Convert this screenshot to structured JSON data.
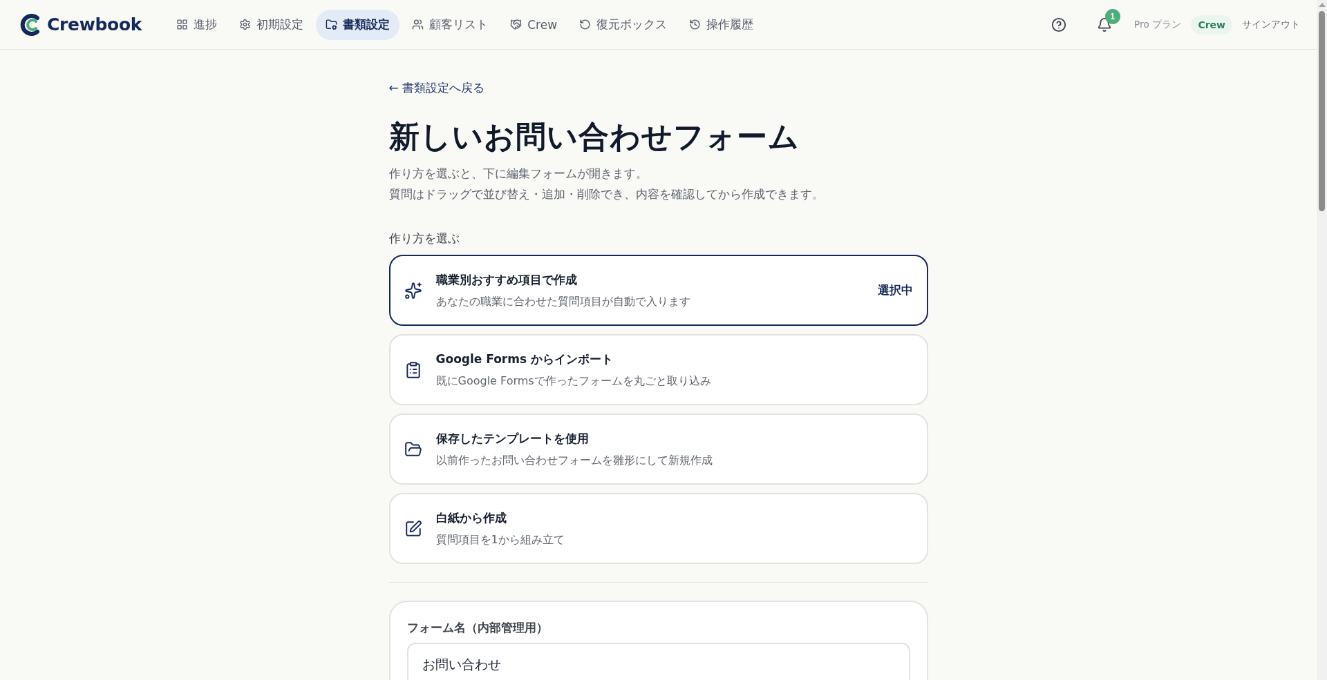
{
  "nav": {
    "logo": "Crewbook",
    "items": [
      {
        "label": "進捗",
        "selected": false
      },
      {
        "label": "初期設定",
        "selected": false
      },
      {
        "label": "書類設定",
        "selected": true
      },
      {
        "label": "顧客リスト",
        "selected": false
      },
      {
        "label": "Crew",
        "selected": false
      },
      {
        "label": "復元ボックス",
        "selected": false
      },
      {
        "label": "操作履歴",
        "selected": false
      }
    ]
  },
  "header_right": {
    "notification_count": "1",
    "plan": "Pro プラン",
    "user": "Crew",
    "signout": "サインアウト"
  },
  "back_link": "← 書類設定へ戻る",
  "title": "新しいお問い合わせフォーム",
  "description": [
    "作り方を選ぶと、下に編集フォームが開きます。",
    "質問はドラッグで並び替え・追加・削除でき、内容を確認してから作成できます。"
  ],
  "method_label": "作り方を選ぶ",
  "methods": [
    {
      "title": "職業別おすすめ項目で作成",
      "subtitle": "あなたの職業に合わせた質問項目が自動で入ります",
      "selected": true,
      "status": "選択中"
    },
    {
      "title": "Google Forms からインポート",
      "subtitle": "既にGoogle Formsで作ったフォームを丸ごと取り込み",
      "selected": false
    },
    {
      "title": "保存したテンプレートを使用",
      "subtitle": "以前作ったお問い合わせフォームを雛形にして新規作成",
      "selected": false
    },
    {
      "title": "白紙から作成",
      "subtitle": "質問項目を1から組み立て",
      "selected": false
    }
  ],
  "form": {
    "label": "フォーム名（内部管理用）",
    "value": "お問い合わせ"
  }
}
